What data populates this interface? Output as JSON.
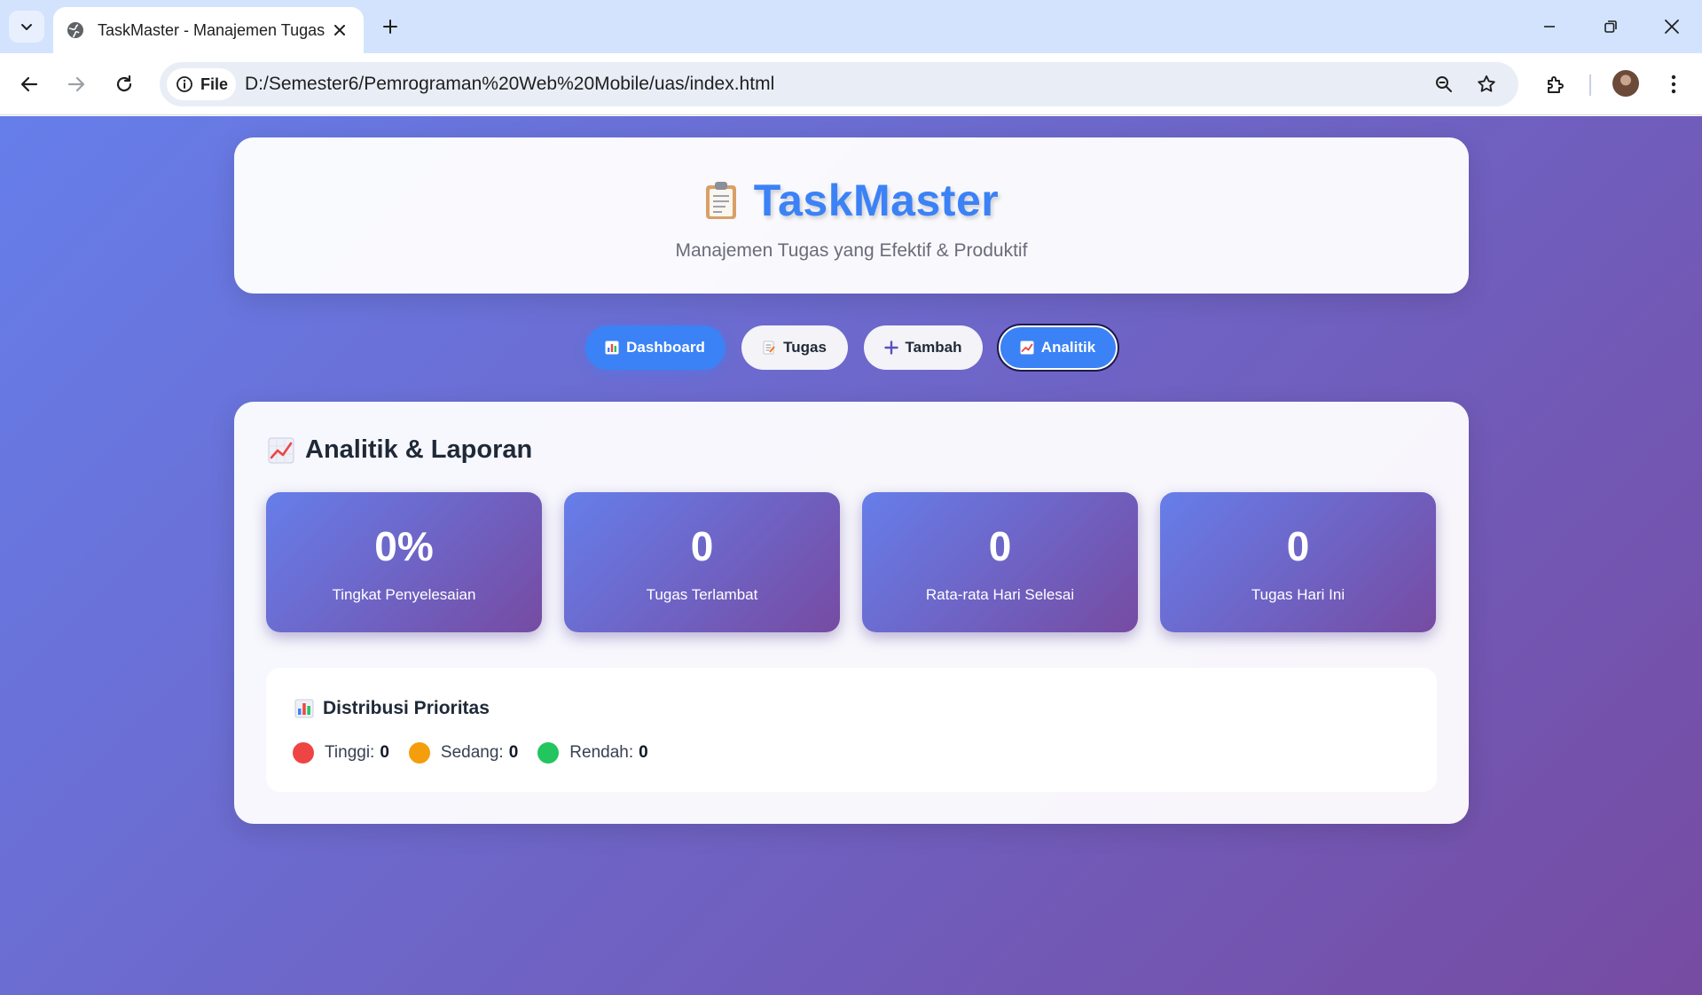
{
  "browser": {
    "tab_title": "TaskMaster - Manajemen Tugas",
    "site_chip": "File",
    "url": "D:/Semester6/Pemrograman%20Web%20Mobile/uas/index.html"
  },
  "header": {
    "title": "TaskMaster",
    "subtitle": "Manajemen Tugas yang Efektif & Produktif"
  },
  "nav": {
    "dashboard": "Dashboard",
    "tugas": "Tugas",
    "tambah": "Tambah",
    "analitik": "Analitik",
    "active": "Analitik"
  },
  "analytics": {
    "title": "Analitik & Laporan",
    "stats": [
      {
        "value": "0%",
        "label": "Tingkat Penyelesaian"
      },
      {
        "value": "0",
        "label": "Tugas Terlambat"
      },
      {
        "value": "0",
        "label": "Rata-rata Hari Selesai"
      },
      {
        "value": "0",
        "label": "Tugas Hari Ini"
      }
    ],
    "distribution": {
      "title": "Distribusi Prioritas",
      "items": [
        {
          "label": "Tinggi:",
          "value": "0",
          "color": "#ef4444"
        },
        {
          "label": "Sedang:",
          "value": "0",
          "color": "#f59e0b"
        },
        {
          "label": "Rendah:",
          "value": "0",
          "color": "#22c55e"
        }
      ]
    }
  },
  "colors": {
    "accent": "#3b82f6",
    "gradient_start": "#667eea",
    "gradient_end": "#764ba2"
  }
}
